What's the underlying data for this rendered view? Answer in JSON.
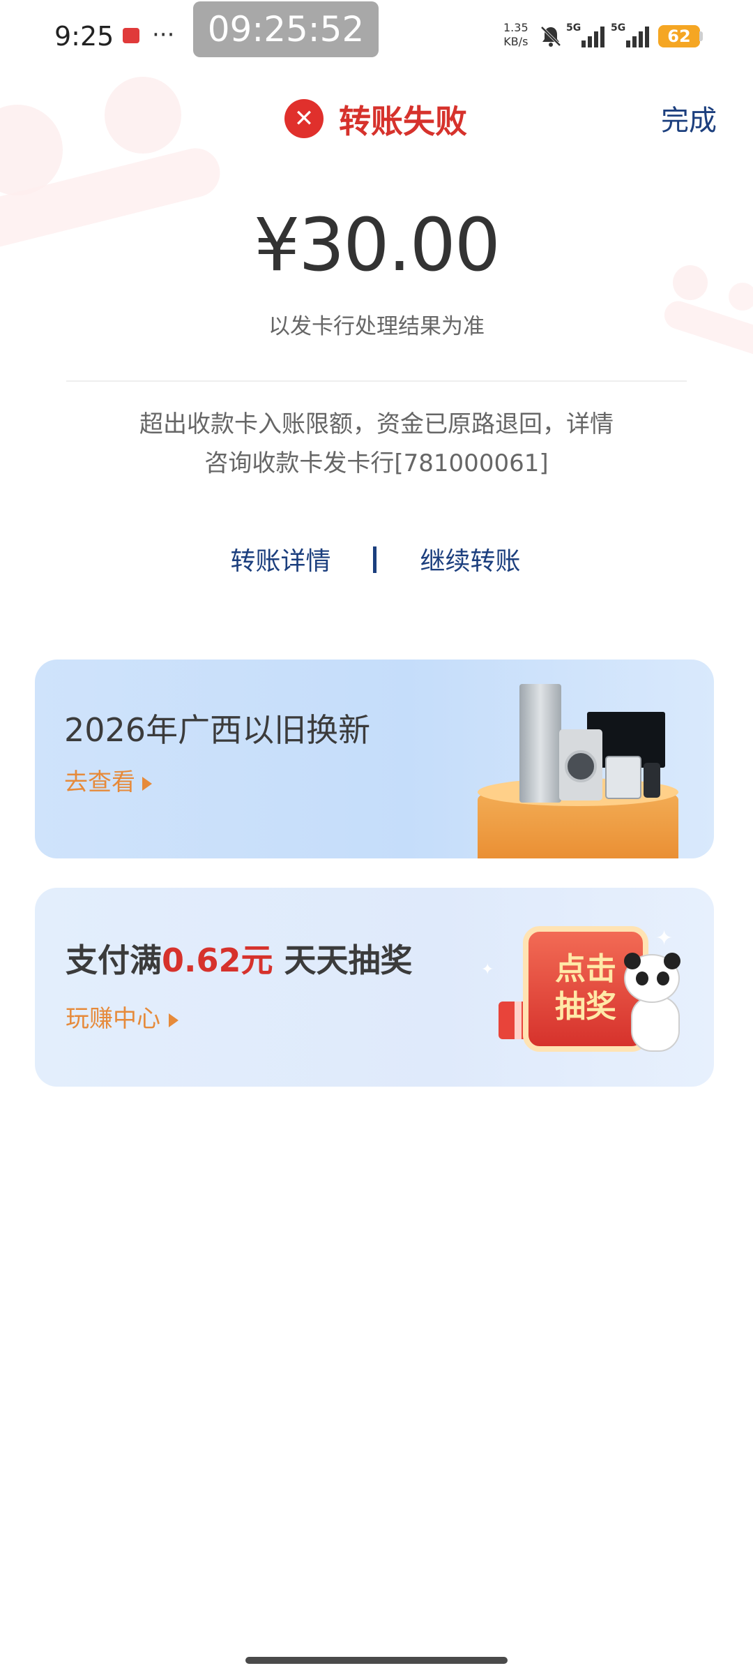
{
  "status_bar": {
    "time": "9:25",
    "dots": "···",
    "clock": "09:25:52",
    "net_speed_value": "1.35",
    "net_speed_unit": "KB/s",
    "signal_1": "5G",
    "signal_2": "5G",
    "battery": "62"
  },
  "header": {
    "title": "转账失败",
    "done": "完成"
  },
  "amount": "¥30.00",
  "amount_note": "以发卡行处理结果为准",
  "reason_line1": "超出收款卡入账限额，资金已原路退回，详情",
  "reason_line2": "咨询收款卡发卡行[781000061]",
  "actions": {
    "detail": "转账详情",
    "continue": "继续转账"
  },
  "banner_trade_in": {
    "title": "2026年广西以旧换新",
    "link": "去查看"
  },
  "banner_lottery": {
    "title_prefix": "支付满",
    "title_highlight": "0.62元",
    "title_suffix": " 天天抽奖",
    "link": "玩赚中心",
    "card_line1": "点击",
    "card_line2": "抽奖"
  },
  "colors": {
    "fail_red": "#d6322c",
    "link_blue": "#1c3f7e",
    "accent_orange": "#e68a3a",
    "battery": "#f5a623"
  }
}
